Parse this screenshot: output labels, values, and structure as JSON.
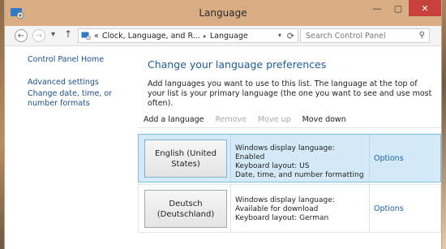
{
  "window": {
    "title": "Language"
  },
  "caption": {
    "minimize": "—",
    "maximize": "▢",
    "close": "✕"
  },
  "nav": {
    "back": "←",
    "forward": "→",
    "recent": "▾",
    "up": "↑",
    "breadcrumb": [
      "Clock, Language, and R...",
      "Language"
    ],
    "breadcrumb_prefix": "«",
    "search_placeholder": "Search Control Panel"
  },
  "sidebar": {
    "home": "Control Panel Home",
    "links": [
      "Advanced settings",
      "Change date, time, or number formats"
    ]
  },
  "main": {
    "heading": "Change your language preferences",
    "description": "Add languages you want to use to this list. The language at the top of your list is your primary language (the one you want to see and use most often).",
    "toolbar": {
      "add": "Add a language",
      "remove": "Remove",
      "move_up": "Move up",
      "move_down": "Move down"
    },
    "languages": [
      {
        "name": "English (United States)",
        "details": [
          "Windows display language: Enabled",
          "Keyboard layout: US",
          "Date, time, and number formatting"
        ],
        "options": "Options",
        "selected": true
      },
      {
        "name": "Deutsch (Deutschland)",
        "details": [
          "Windows display language: Available for download",
          "Keyboard layout: German"
        ],
        "options": "Options",
        "selected": false
      }
    ]
  },
  "colors": {
    "accent": "#1f5b9a",
    "link": "#1e4f8c",
    "selection": "#d4eaf8",
    "titlebar": "#d8ad84",
    "close": "#c7403a"
  },
  "icons": [
    "control-panel-icon",
    "back-icon",
    "forward-icon",
    "up-icon",
    "refresh-icon",
    "search-icon"
  ]
}
